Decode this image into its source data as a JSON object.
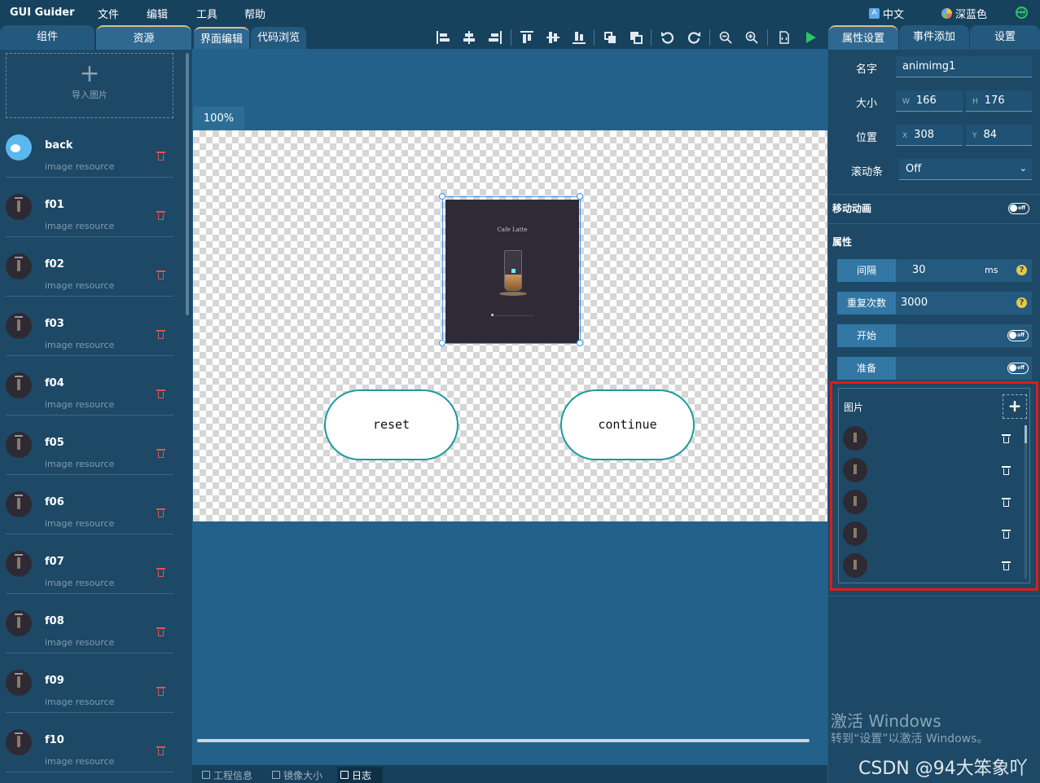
{
  "menubar": {
    "app_name": "GUI Guider",
    "items": [
      "文件",
      "编辑",
      "工具",
      "帮助"
    ],
    "language": "中文",
    "theme": "深蓝色",
    "icons": {
      "language": "translate-icon",
      "theme": "palette-icon",
      "web": "globe-icon"
    }
  },
  "left_tabs": [
    "组件",
    "资源"
  ],
  "left_active_tab": "资源",
  "import": {
    "plus": "+",
    "label": "导入图片"
  },
  "resources": [
    {
      "name": "back",
      "sub": "image resource",
      "thumb": "blue-dots"
    },
    {
      "name": "f01",
      "sub": "image resource",
      "thumb": "coffee-cup"
    },
    {
      "name": "f02",
      "sub": "image resource",
      "thumb": "coffee-cup"
    },
    {
      "name": "f03",
      "sub": "image resource",
      "thumb": "coffee-cup"
    },
    {
      "name": "f04",
      "sub": "image resource",
      "thumb": "coffee-cup"
    },
    {
      "name": "f05",
      "sub": "image resource",
      "thumb": "coffee-cup"
    },
    {
      "name": "f06",
      "sub": "image resource",
      "thumb": "coffee-cup"
    },
    {
      "name": "f07",
      "sub": "image resource",
      "thumb": "coffee-cup"
    },
    {
      "name": "f08",
      "sub": "image resource",
      "thumb": "coffee-cup"
    },
    {
      "name": "f09",
      "sub": "image resource",
      "thumb": "coffee-cup"
    },
    {
      "name": "f10",
      "sub": "image resource",
      "thumb": "coffee-cup"
    }
  ],
  "editor_tabs": [
    "界面编辑",
    "代码浏览"
  ],
  "editor_active_tab": "界面编辑",
  "toolbar_icons": [
    "align-left-icon",
    "align-center-h-icon",
    "align-right-icon",
    "align-top-icon",
    "align-center-v-icon",
    "align-bottom-icon",
    "bring-forward-icon",
    "send-backward-icon",
    "undo-icon",
    "redo-icon",
    "zoom-out-icon",
    "zoom-in-icon",
    "export-icon",
    "run-icon"
  ],
  "canvas": {
    "zoom": "100%",
    "image_title": "Cafe Latte",
    "buttons": [
      {
        "label": "reset"
      },
      {
        "label": "continue"
      }
    ]
  },
  "status_tabs": [
    {
      "label": "工程信息",
      "icon": "project-info-icon"
    },
    {
      "label": "镜像大小",
      "icon": "image-size-icon"
    },
    {
      "label": "日志",
      "icon": "log-icon"
    }
  ],
  "status_active": "日志",
  "right_tabs": [
    "属性设置",
    "事件添加",
    "设置"
  ],
  "right_active_tab": "属性设置",
  "props": {
    "name_label": "名字",
    "name": "animimg1",
    "size_label": "大小",
    "w_prefix": "W",
    "w": "166",
    "h_prefix": "H",
    "h": "176",
    "pos_label": "位置",
    "x_prefix": "X",
    "x": "308",
    "y_prefix": "Y",
    "y": "84",
    "scroll_label": "滚动条",
    "scroll": "Off",
    "move_anim_label": "移动动画",
    "attrs_title": "属性",
    "interval_label": "间隔",
    "interval": "30",
    "interval_unit": "ms",
    "repeat_label": "重复次数",
    "repeat": "3000",
    "start_label": "开始",
    "ready_label": "准备",
    "toggle_text": "off",
    "help": "?"
  },
  "images_section": {
    "title": "图片",
    "add": "+",
    "count": 5
  },
  "colors": {
    "background": "#1d4966",
    "highlight_box": "#e01b1b",
    "selection": "#3a96e8",
    "button_border": "#1c9a9e",
    "run": "#2ec26b",
    "delete_red": "#e05555"
  },
  "watermark": {
    "line1": "激活 Windows",
    "line2": "转到“设置”以激活 Windows。"
  },
  "credit": "CSDN @94大笨象吖"
}
